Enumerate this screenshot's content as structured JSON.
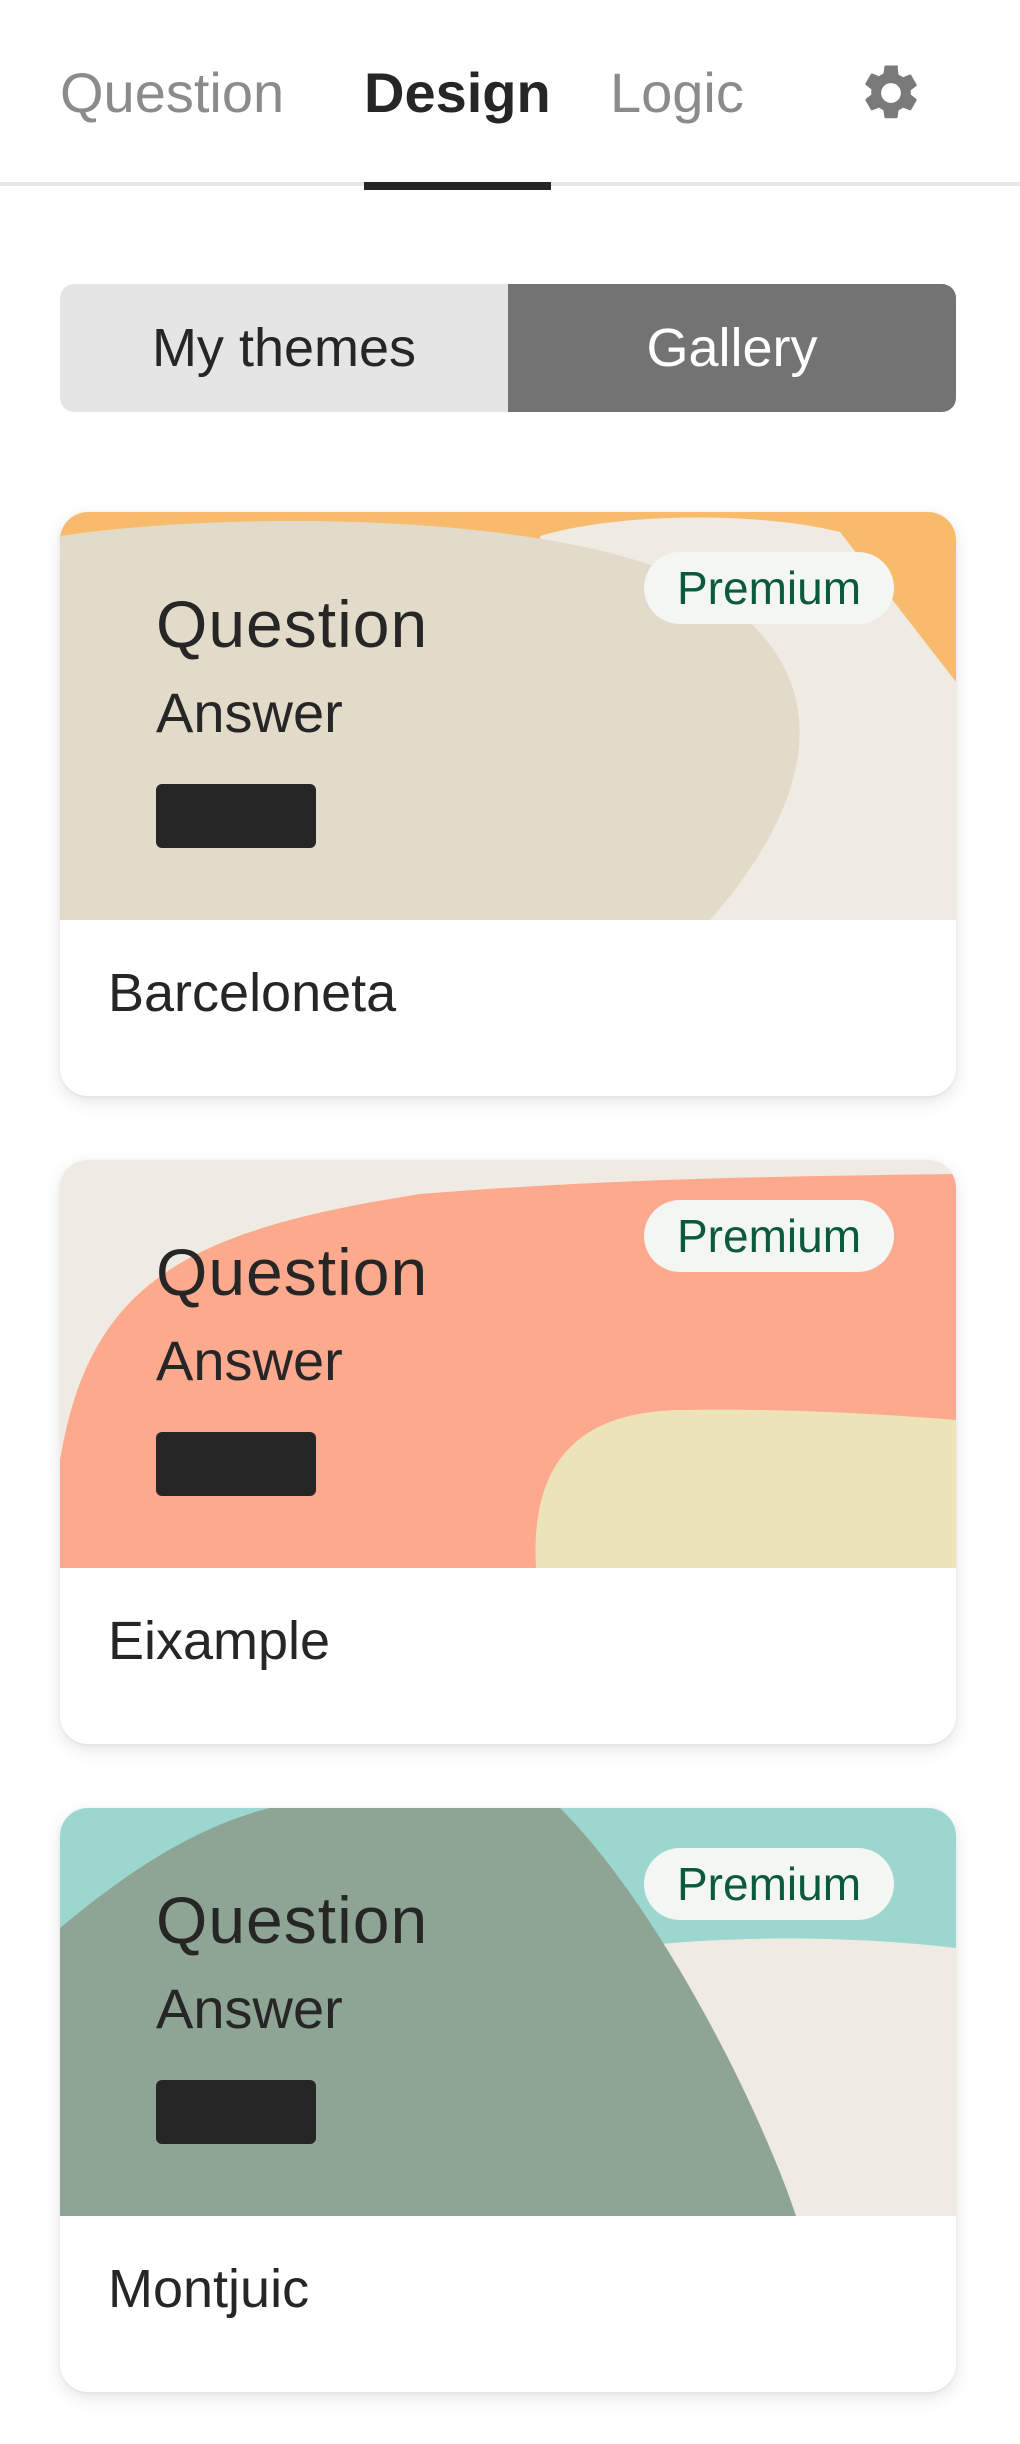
{
  "tabs": {
    "question": "Question",
    "design": "Design",
    "logic": "Logic",
    "active": "Design"
  },
  "icons": {
    "settings": "gear-icon"
  },
  "segment": {
    "my_themes": "My themes",
    "gallery": "Gallery",
    "active": "Gallery"
  },
  "themes": [
    {
      "name": "Barceloneta",
      "badge": "Premium",
      "preview": {
        "question": "Question",
        "answer": "Answer"
      },
      "colors": {
        "base": "#e3dbc9",
        "accent": "#f8bb6c",
        "light": "#efebe3"
      }
    },
    {
      "name": "Eixample",
      "badge": "Premium",
      "preview": {
        "question": "Question",
        "answer": "Answer"
      },
      "colors": {
        "base": "#efebe3",
        "accent": "#fda98e",
        "light": "#ece4b8"
      }
    },
    {
      "name": "Montjuic",
      "badge": "Premium",
      "preview": {
        "question": "Question",
        "answer": "Answer"
      },
      "colors": {
        "base": "#9cd7cf",
        "accent": "#8ea495",
        "light": "#efebe3"
      }
    }
  ],
  "colors": {
    "text": "#262627",
    "badge_text": "#0b5a3c",
    "segment_active": "#737373"
  }
}
